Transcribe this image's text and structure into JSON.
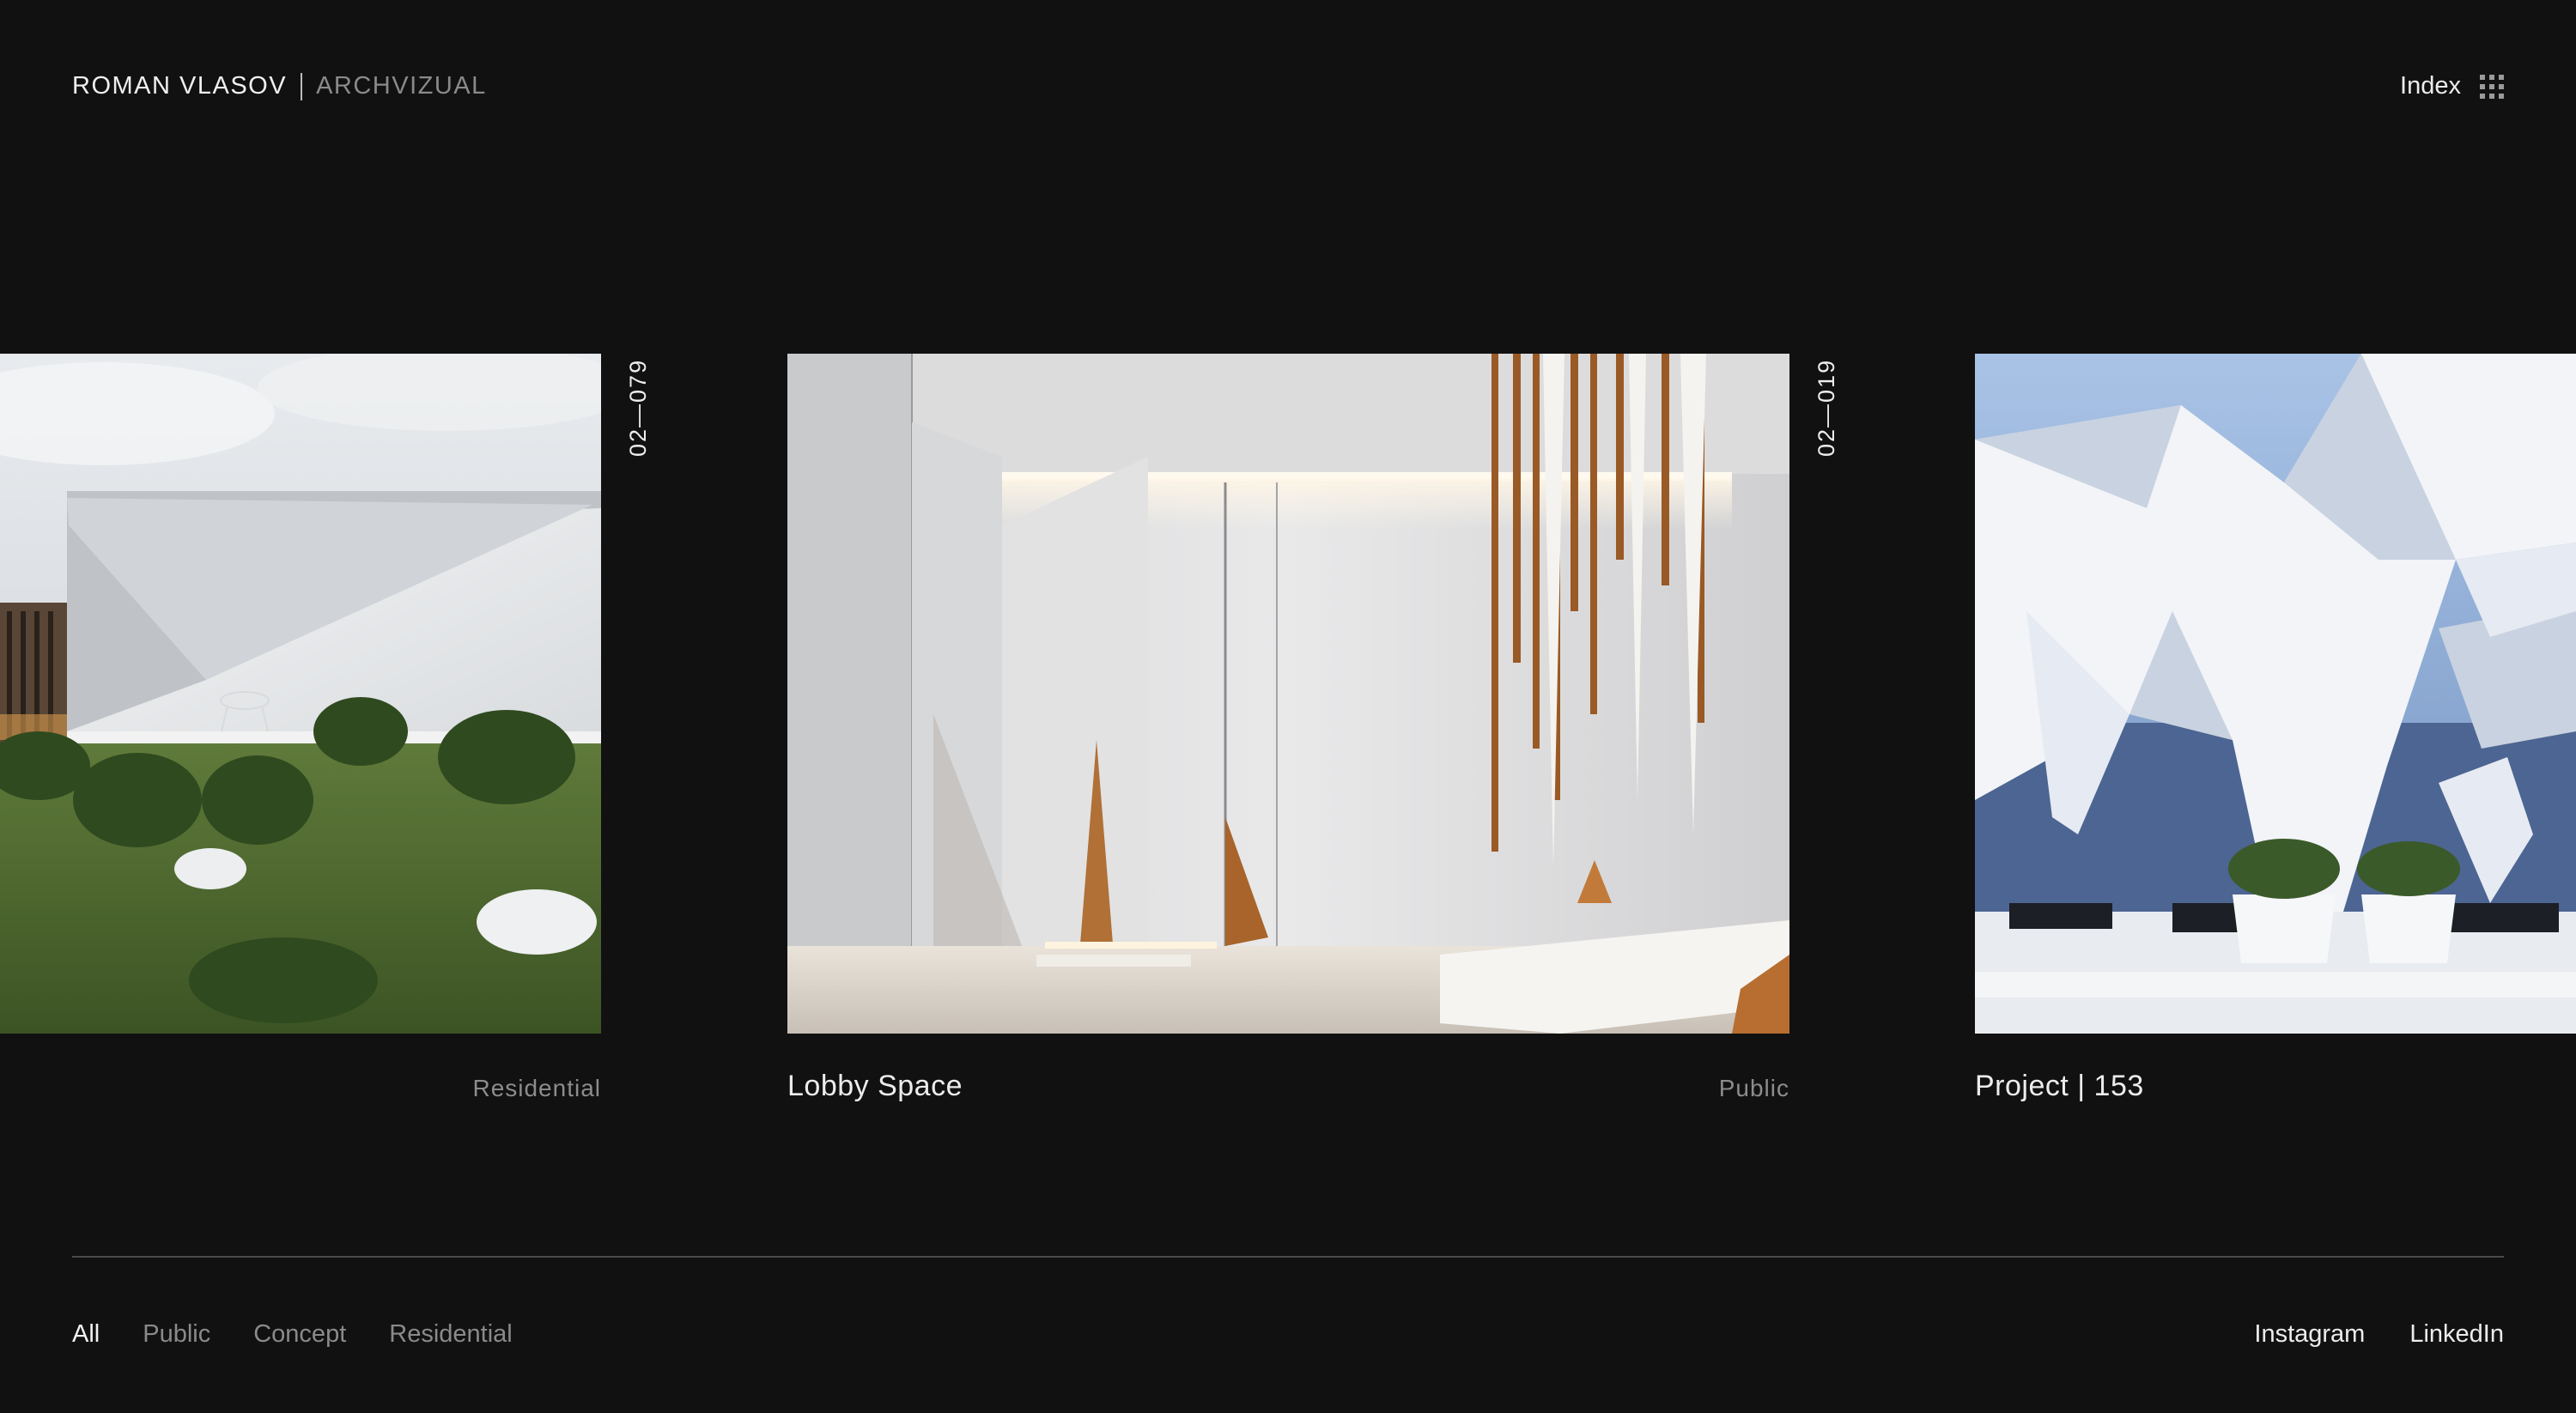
{
  "header": {
    "brand_name": "ROMAN VLASOV",
    "brand_sub": "ARCHVIZUAL",
    "index_label": "Index",
    "index_icon": "grid-icon"
  },
  "projects": [
    {
      "code": "02—079",
      "title": "",
      "category": "Residential"
    },
    {
      "code": "02—019",
      "title": "Lobby Space",
      "category": "Public"
    },
    {
      "code": "",
      "title": "Project | 153",
      "category": ""
    }
  ],
  "filters": [
    {
      "label": "All",
      "active": true
    },
    {
      "label": "Public",
      "active": false
    },
    {
      "label": "Concept",
      "active": false
    },
    {
      "label": "Residential",
      "active": false
    }
  ],
  "social": [
    "Instagram",
    "LinkedIn"
  ],
  "colors": {
    "background": "#111112",
    "text": "#ececec",
    "muted": "#8a8a8a"
  }
}
